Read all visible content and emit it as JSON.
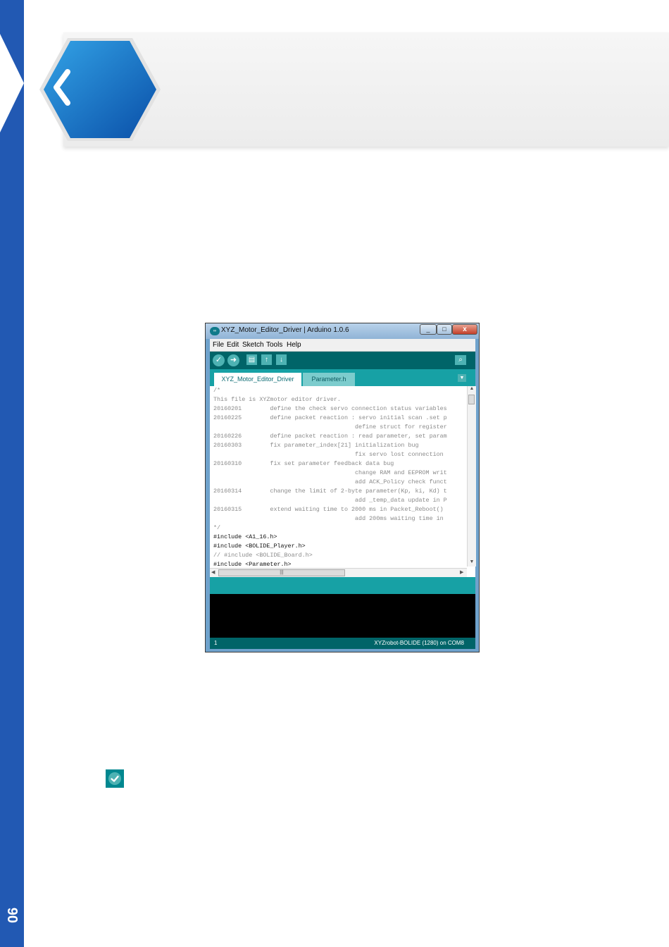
{
  "page": {
    "number": "90"
  },
  "ide": {
    "title": "XYZ_Motor_Editor_Driver | Arduino 1.0.6",
    "close_glyph": "x",
    "menu": [
      "File",
      "Edit",
      "Sketch",
      "Tools",
      "Help"
    ],
    "toolbar": {
      "verify_glyph": "✓",
      "upload_glyph": "➜",
      "new_glyph": "▤",
      "open_glyph": "↑",
      "save_glyph": "↓",
      "serial_glyph": "⌕"
    },
    "tabs": [
      "XYZ_Motor_Editor_Driver",
      "Parameter.h"
    ],
    "tab_menu_glyph": "▼",
    "code_lines": [
      "/*",
      "This file is XYZmotor editor driver.",
      "20160201        define the check servo connection status variables",
      "20160225        define packet reaction : servo initial scan .set p",
      "                                        define struct for register",
      "20160226        define packet reaction : read parameter, set param",
      "20160303        fix parameter_index[21] initialization bug",
      "                                        fix servo lost connection",
      "20160310        fix set parameter feedback data bug",
      "                                        change RAM and EEPROM writ",
      "                                        add ACK_Policy check funct",
      "20160314        change the limit of 2-byte parameter(Kp, ki, Kd) t",
      "                                        add _temp_data update in P",
      "20160315        extend waiting time to 2000 ms in Packet_Reboot()",
      "                                        add 200ms waiting time in",
      "*/",
      "#include <A1_16.h>",
      "#include <BOLIDE_Player.h>",
      "// #include <BOLIDE_Board.h>",
      "#include <Parameter.h>"
    ],
    "hscroll_grip": "|||",
    "line_number": "1",
    "board": "XYZrobot-BOLIDE (1280) on COM8"
  }
}
